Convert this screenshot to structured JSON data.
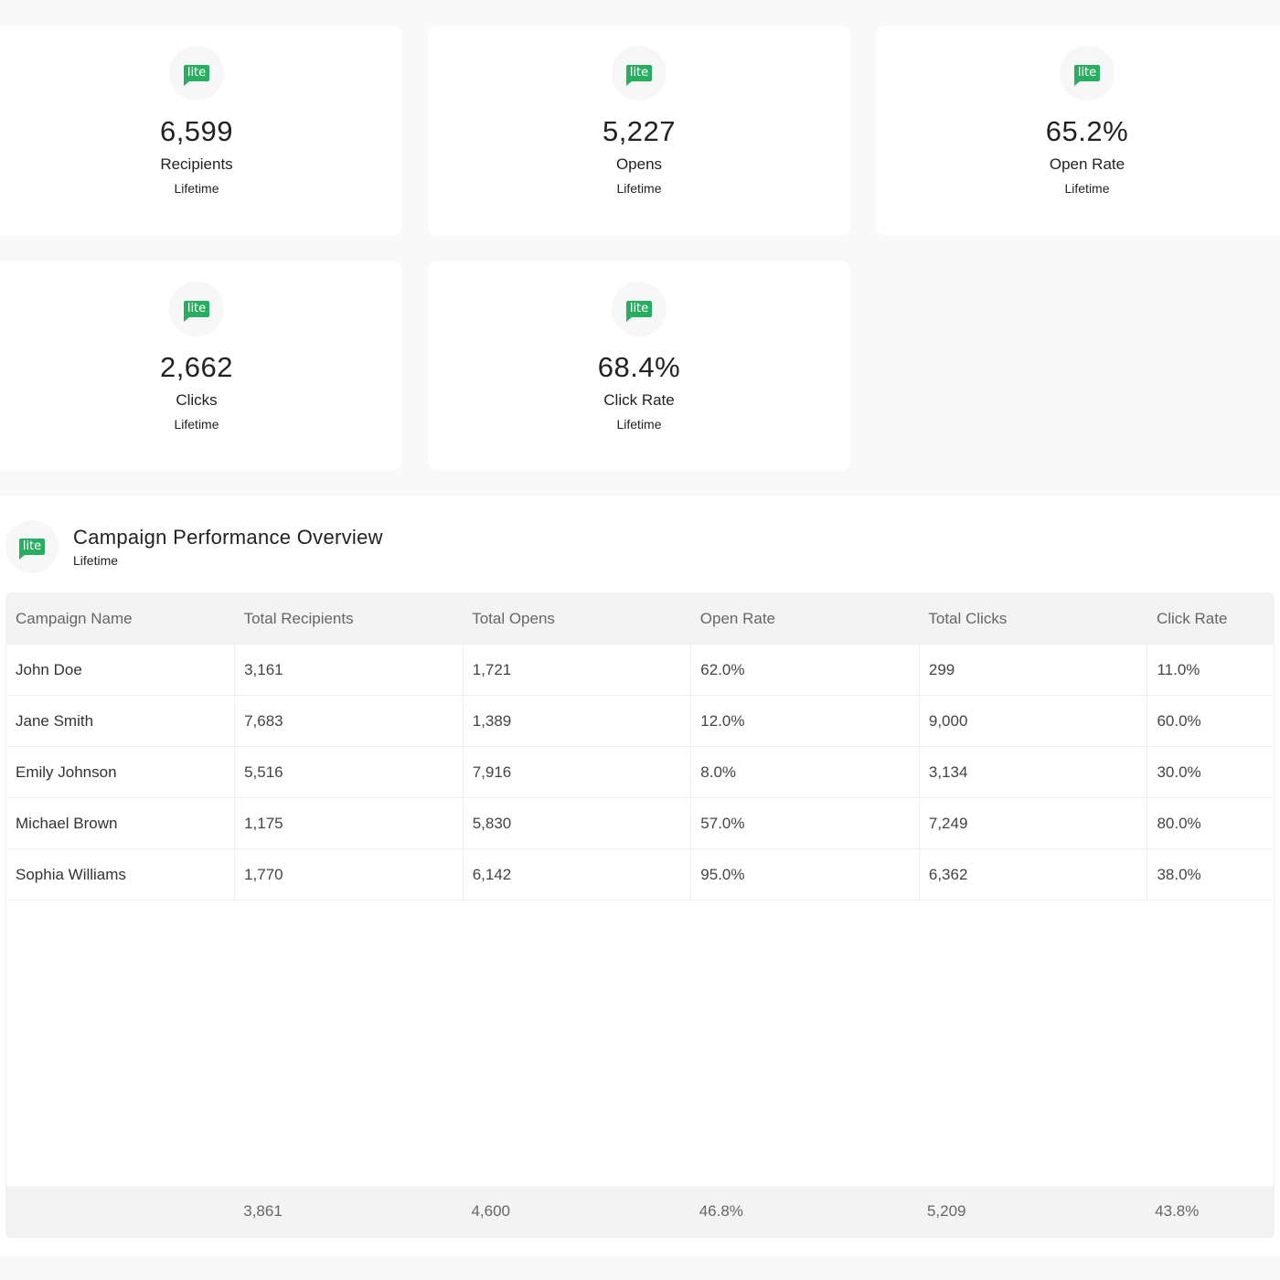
{
  "stats": [
    {
      "value": "6,599",
      "label": "Recipients",
      "period": "Lifetime"
    },
    {
      "value": "5,227",
      "label": "Opens",
      "period": "Lifetime"
    },
    {
      "value": "65.2%",
      "label": "Open Rate",
      "period": "Lifetime"
    },
    {
      "value": "2,662",
      "label": "Clicks",
      "period": "Lifetime"
    },
    {
      "value": "68.4%",
      "label": "Click Rate",
      "period": "Lifetime"
    }
  ],
  "logo_text": "lite",
  "brand_color": "#27ae60",
  "overview": {
    "title": "Campaign Performance Overview",
    "subtitle": "Lifetime",
    "columns": [
      "Campaign Name",
      "Total Recipients",
      "Total Opens",
      "Open Rate",
      "Total Clicks",
      "Click Rate"
    ],
    "rows": [
      [
        "John Doe",
        "3,161",
        "1,721",
        "62.0%",
        "299",
        "11.0%"
      ],
      [
        "Jane Smith",
        "7,683",
        "1,389",
        "12.0%",
        "9,000",
        "60.0%"
      ],
      [
        "Emily Johnson",
        "5,516",
        "7,916",
        "8.0%",
        "3,134",
        "30.0%"
      ],
      [
        "Michael Brown",
        "1,175",
        "5,830",
        "57.0%",
        "7,249",
        "80.0%"
      ],
      [
        "Sophia Williams",
        "1,770",
        "6,142",
        "95.0%",
        "6,362",
        "38.0%"
      ]
    ],
    "totals": [
      "",
      "3,861",
      "4,600",
      "46.8%",
      "5,209",
      "43.8%"
    ]
  }
}
